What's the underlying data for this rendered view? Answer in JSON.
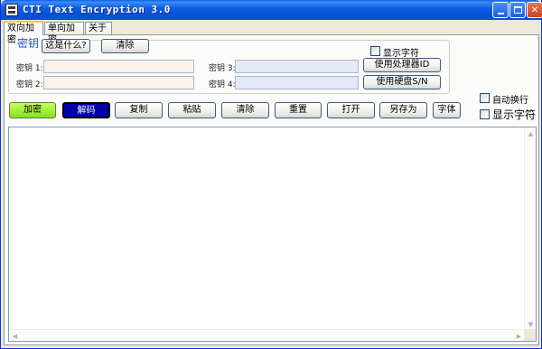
{
  "window": {
    "title": "CTI Text Encryption 3.0",
    "controls": {
      "minimize": "_",
      "maximize": "□",
      "close": "✕"
    }
  },
  "tabs": [
    {
      "label": "双向加密",
      "active": true
    },
    {
      "label": "单向加密",
      "active": false
    },
    {
      "label": "关于",
      "active": false
    }
  ],
  "keys": {
    "group_title": "密钥",
    "what_button": "这是什么?",
    "clear_button": "清除",
    "show_chars_label": "显示字符",
    "key1_label": "密钥 1:",
    "key2_label": "密钥 2:",
    "key3_label": "密钥 3:",
    "key4_label": "密钥 4:",
    "key1_value": "",
    "key2_value": "",
    "key3_value": "",
    "key4_value": "",
    "use_cpu_id_button": "使用处理器ID",
    "use_disk_sn_button": "使用硬盘S/N"
  },
  "toolbar": {
    "encrypt": "加密",
    "decrypt": "解码",
    "copy": "复制",
    "paste": "粘贴",
    "clear": "清除",
    "reset": "重置",
    "open": "打开",
    "save_as": "另存为",
    "font": "字体"
  },
  "options": {
    "auto_wrap": "自动换行",
    "show_chars": "显示字符"
  },
  "editor": {
    "content": ""
  },
  "colors": {
    "titlebar": "#0a52d8",
    "encrypt_button": "#87e01b",
    "decrypt_button": "#0000a8",
    "key_field_pink": "#fdf1ec",
    "key_field_blue": "#e5e8f8",
    "group_title": "#1e56c9"
  },
  "icons": {
    "app": "app-icon",
    "minimize": "minimize-icon",
    "maximize": "maximize-icon",
    "close": "close-icon"
  }
}
